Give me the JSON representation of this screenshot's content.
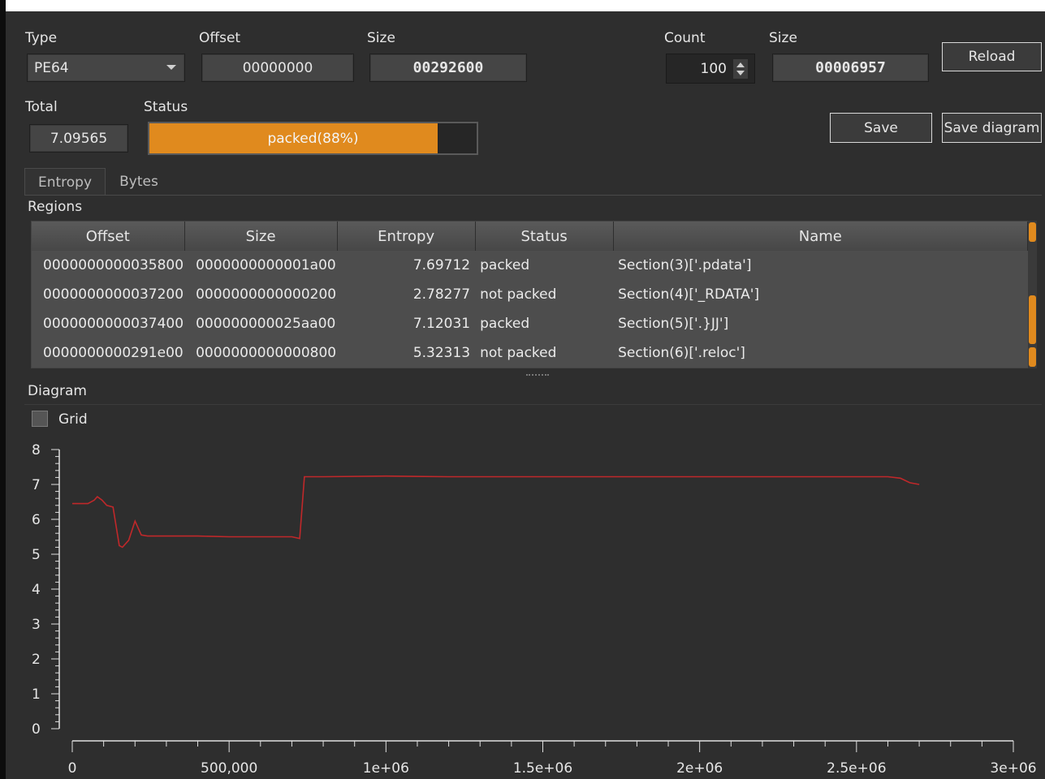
{
  "labels": {
    "type": "Type",
    "offset": "Offset",
    "size": "Size",
    "count": "Count",
    "size2": "Size",
    "total": "Total",
    "status": "Status",
    "regions": "Regions",
    "diagram": "Diagram"
  },
  "fields": {
    "type_value": "PE64",
    "offset_value": "00000000",
    "size_value": "00292600",
    "count_value": "100",
    "size2_value": "00006957",
    "total_value": "7.09565"
  },
  "status": {
    "text": "packed(88%)",
    "progress": 0.88,
    "color": "#e08a1e"
  },
  "buttons": {
    "reload": "Reload",
    "save": "Save",
    "save_diagram": "Save diagram"
  },
  "tabs": [
    {
      "label": "Entropy",
      "active": true
    },
    {
      "label": "Bytes",
      "active": false
    }
  ],
  "table": {
    "columns": [
      "Offset",
      "Size",
      "Entropy",
      "Status",
      "Name"
    ],
    "rows": [
      [
        "0000000000035800",
        "0000000000001a00",
        "7.69712",
        "packed",
        "Section(3)['.pdata']"
      ],
      [
        "0000000000037200",
        "0000000000000200",
        "2.78277",
        "not packed",
        "Section(4)['_RDATA']"
      ],
      [
        "0000000000037400",
        "000000000025aa00",
        "7.12031",
        "packed",
        "Section(5)['.}JJ']"
      ],
      [
        "0000000000291e00",
        "0000000000000800",
        "5.32313",
        "not packed",
        "Section(6)['.reloc']"
      ]
    ]
  },
  "grid": {
    "label": "Grid",
    "checked": false
  },
  "chart_data": {
    "type": "line",
    "title": "",
    "xlabel": "",
    "ylabel": "",
    "xlim": [
      0,
      3000000
    ],
    "ylim": [
      0,
      8
    ],
    "grid": false,
    "x_ticks": [
      0,
      500000,
      1000000,
      1500000,
      2000000,
      2500000,
      3000000
    ],
    "x_tick_labels": [
      "0",
      "500,000",
      "1e+06",
      "1.5e+06",
      "2e+06",
      "2.5e+06",
      "3e+06"
    ],
    "y_ticks": [
      0,
      1,
      2,
      3,
      4,
      5,
      6,
      7,
      8
    ],
    "y_tick_labels": [
      "0",
      "1",
      "2",
      "3",
      "4",
      "5",
      "6",
      "7",
      "8"
    ],
    "line_color": "#c0282a",
    "series": [
      {
        "x": [
          0,
          50000,
          70000,
          80000,
          95000,
          110000,
          130000,
          150000,
          160000,
          180000,
          200000,
          220000,
          240000,
          300000,
          400000,
          500000,
          600000,
          700000,
          725000,
          740000,
          760000,
          800000,
          1000000,
          1200000,
          1500000,
          1800000,
          2000000,
          2300000,
          2500000,
          2600000,
          2640000,
          2670000,
          2700000
        ],
        "y": [
          6.45,
          6.45,
          6.55,
          6.65,
          6.55,
          6.4,
          6.35,
          5.25,
          5.2,
          5.4,
          5.95,
          5.55,
          5.52,
          5.52,
          5.52,
          5.5,
          5.5,
          5.5,
          5.45,
          7.22,
          7.22,
          7.22,
          7.24,
          7.22,
          7.22,
          7.22,
          7.22,
          7.22,
          7.22,
          7.22,
          7.18,
          7.05,
          7.0
        ]
      }
    ]
  }
}
